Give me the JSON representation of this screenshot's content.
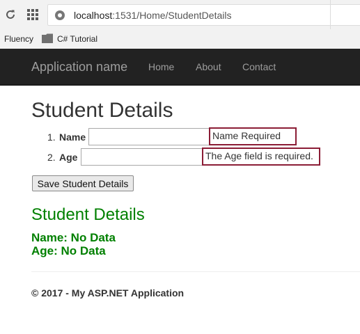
{
  "browser": {
    "url_host": "localhost",
    "url_path": ":1531/Home/StudentDetails",
    "bookmarks": [
      {
        "label": "Fluency"
      },
      {
        "label": "C# Tutorial"
      }
    ]
  },
  "navbar": {
    "brand": "Application name",
    "links": [
      "Home",
      "About",
      "Contact"
    ]
  },
  "page": {
    "title": "Student Details",
    "fields": [
      {
        "number": "1.",
        "label": "Name",
        "value": "",
        "error": "Name Required"
      },
      {
        "number": "2.",
        "label": "Age",
        "value": "",
        "error": "The Age field is required."
      }
    ],
    "submit_label": "Save Student Details",
    "details_heading": "Student Details",
    "name_line": "Name: No Data",
    "age_line": "Age: No Data"
  },
  "footer": {
    "text": "© 2017 - My ASP.NET Application"
  },
  "colors": {
    "navbar_bg": "#222222",
    "error_border": "#8b1c35",
    "details_green": "#008000"
  }
}
